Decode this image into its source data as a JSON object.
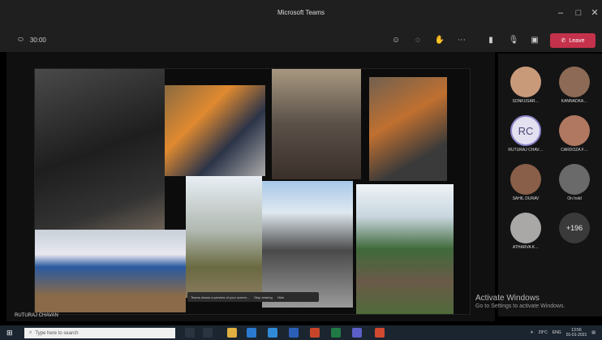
{
  "window": {
    "title": "Microsoft Teams"
  },
  "toolbar": {
    "timer": "30:00",
    "leave_label": "Leave"
  },
  "presenter": {
    "name": "RUTURAJ CHAVAN"
  },
  "share_bar": {
    "message": "Teams shows a preview of your screen...",
    "stop_label": "Stop sharing",
    "hide_label": "Hide"
  },
  "participants": [
    {
      "name": "SONKUSAR…",
      "initials": "",
      "color": "#c99a7a"
    },
    {
      "name": "KANNADKA…",
      "initials": "",
      "color": "#8c6a55"
    },
    {
      "name": "RUTURAJ CHAV…",
      "initials": "RC",
      "color": "#e3e0f0"
    },
    {
      "name": "CARDOZA F…",
      "initials": "",
      "color": "#b07860"
    },
    {
      "name": "SAHIL DURAV",
      "initials": "",
      "color": "#8a5f49"
    },
    {
      "name": "On hold",
      "initials": "",
      "color": "#6a6a6a"
    },
    {
      "name": "ATHARVA K…",
      "initials": "",
      "color": "#aaa8a6"
    },
    {
      "name": "",
      "initials": "+196",
      "color": "#3a3a3a"
    }
  ],
  "watermark": {
    "line1": "Activate Windows",
    "line2": "Go to Settings to activate Windows."
  },
  "taskbar": {
    "search_placeholder": "Type here to search",
    "temperature": "29°C",
    "lang": "ENG",
    "time": "13:56",
    "date": "01-01-2021"
  }
}
